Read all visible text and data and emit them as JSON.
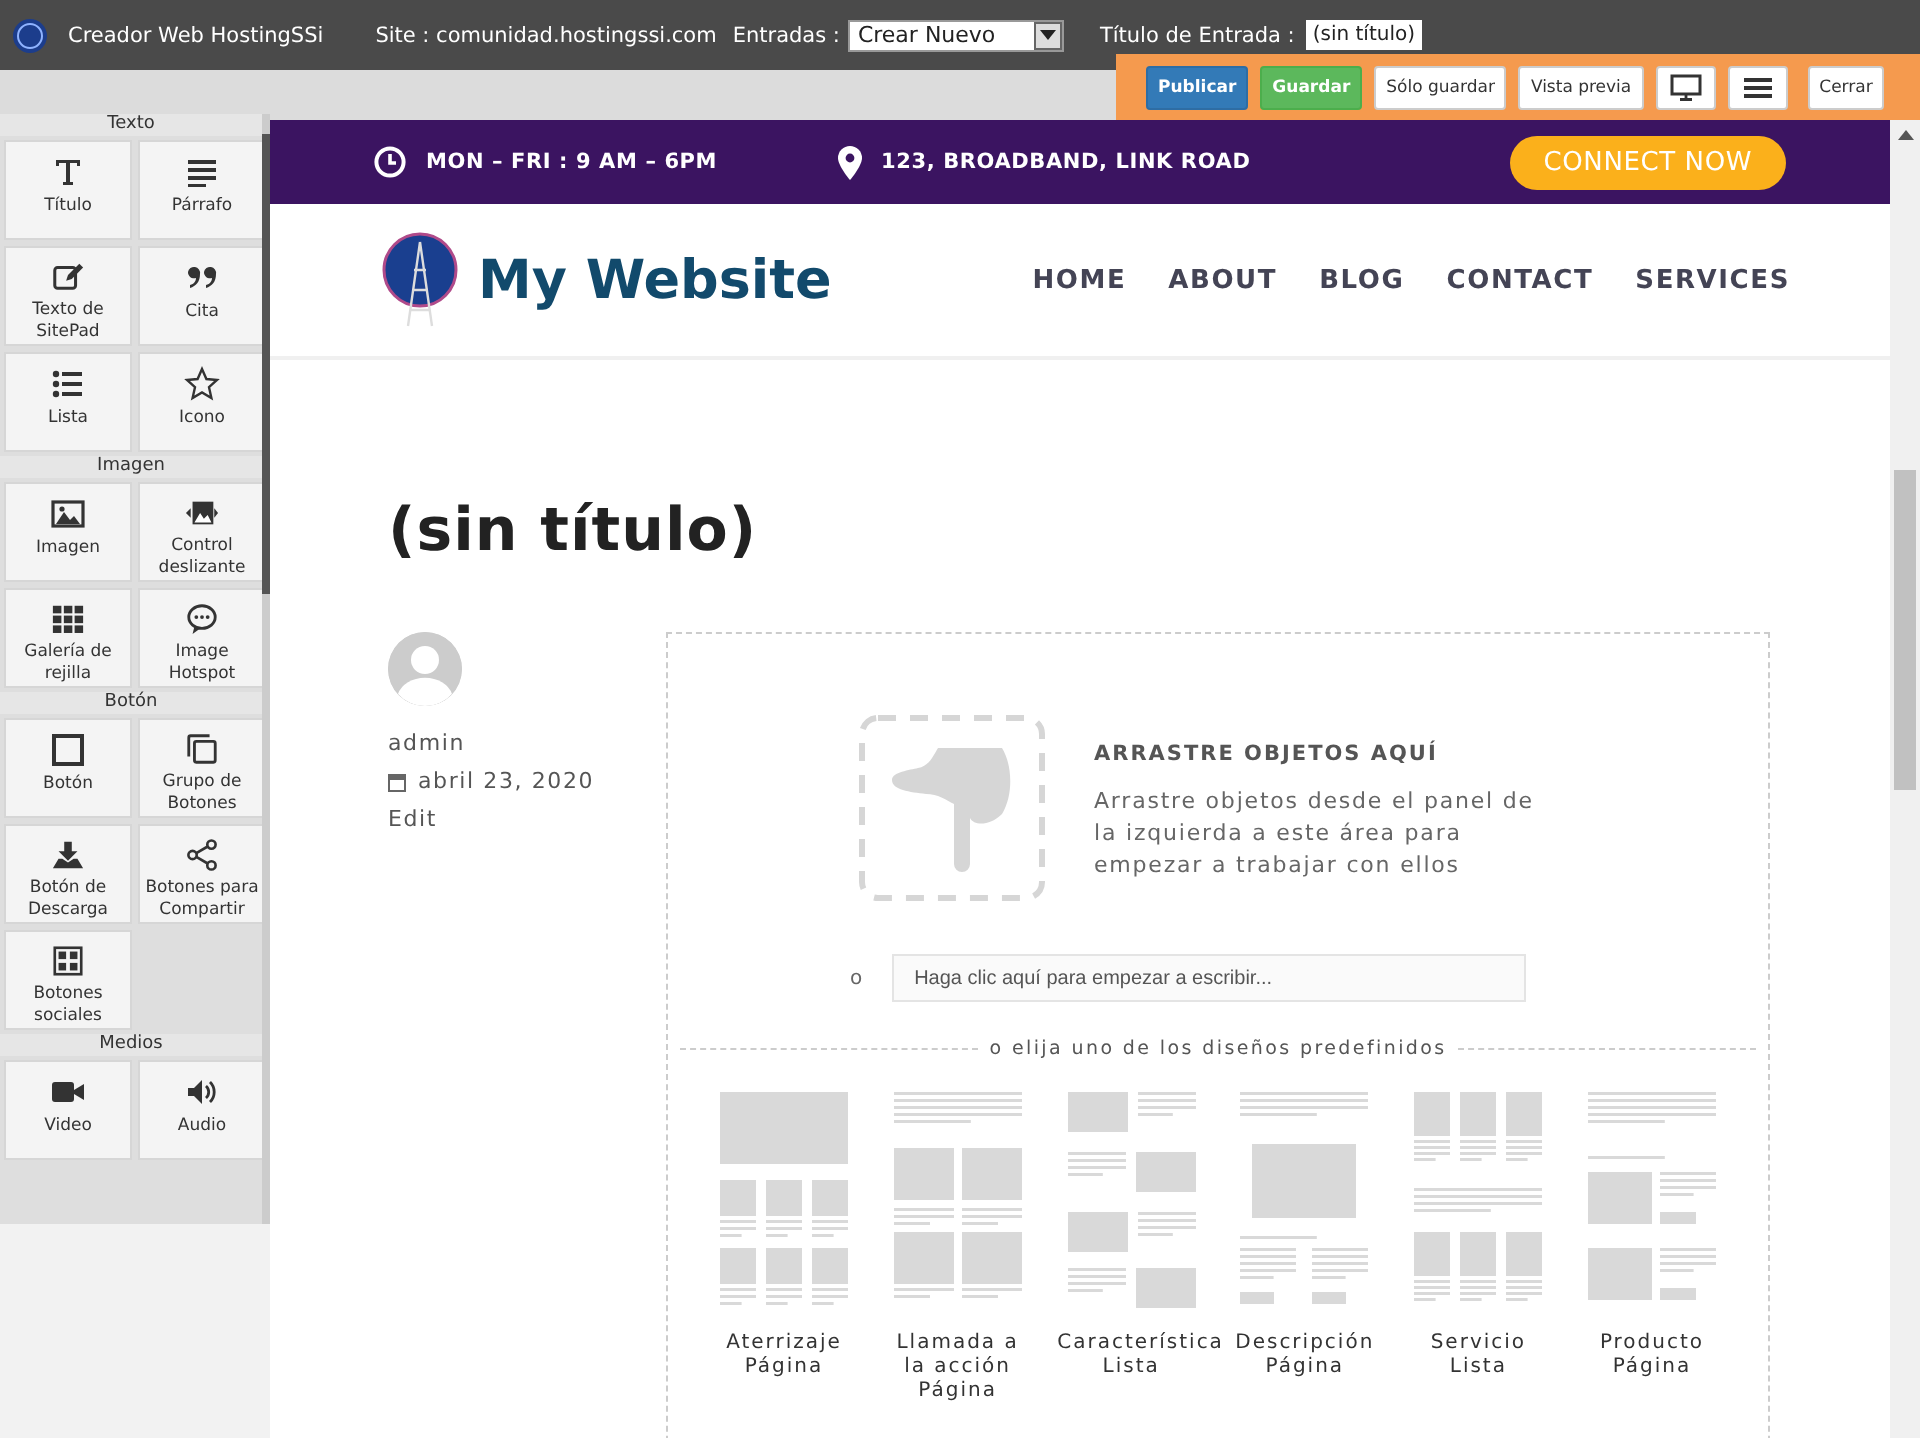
{
  "app": {
    "title": "Creador Web HostingSSi",
    "site": "Site : comunidad.hostingssi.com",
    "entries_label": "Entradas :",
    "entries_value": "Crear Nuevo",
    "entry_title_label": "Título de Entrada :",
    "entry_title_value": "(sin título)"
  },
  "toolbar": [
    {
      "kind": "primary",
      "label": "Publicar"
    },
    {
      "kind": "success",
      "label": "Guardar"
    },
    {
      "kind": "plain",
      "label": "Sólo guardar"
    },
    {
      "kind": "plain",
      "label": "Vista previa"
    },
    {
      "kind": "desktop"
    },
    {
      "kind": "menu"
    },
    {
      "kind": "plain",
      "label": "Cerrar"
    }
  ],
  "sidebar": [
    {
      "title": "Texto",
      "items": [
        {
          "label": "Título"
        },
        {
          "label": "Párrafo"
        },
        {
          "label": "Texto de SitePad"
        },
        {
          "label": "Cita"
        },
        {
          "label": "Lista"
        },
        {
          "label": "Icono"
        }
      ]
    },
    {
      "title": "Imagen",
      "items": [
        {
          "label": "Imagen"
        },
        {
          "label": "Control deslizante"
        },
        {
          "label": "Galería de rejilla"
        },
        {
          "label": "Image Hotspot"
        }
      ]
    },
    {
      "title": "Botón",
      "items": [
        {
          "label": "Botón"
        },
        {
          "label": "Grupo de Botones"
        },
        {
          "label": "Botón de Descarga"
        },
        {
          "label": "Botones para Compartir"
        },
        {
          "label": "Botones sociales"
        }
      ]
    },
    {
      "title": "Medios",
      "items": [
        {
          "label": "Video"
        },
        {
          "label": "Audio"
        }
      ]
    }
  ],
  "site": {
    "hours": "MON – FRI : 9 AM – 6PM",
    "address": "123, BROADBAND, LINK ROAD",
    "cta": "CONNECT NOW",
    "brand": "My Website",
    "nav": [
      "HOME",
      "ABOUT",
      "BLOG",
      "CONTACT",
      "SERVICES"
    ]
  },
  "post": {
    "title": "(sin título)",
    "author": "admin",
    "date": "abril 23, 2020",
    "edit": "Edit"
  },
  "dropzone": {
    "heading": "ARRASTRE OBJETOS AQUÍ",
    "text": "Arrastre objetos desde el panel de la izquierda a este área para empezar a trabajar con ellos",
    "or": "o",
    "placeholder": "Haga clic aquí para empezar a escribir...",
    "divider": "o elija uno de los diseños predefinidos",
    "layouts": [
      {
        "label": "Aterrizaje Página"
      },
      {
        "label": "Llamada a la acción Página"
      },
      {
        "label": "Característica Lista"
      },
      {
        "label": "Descripción Página"
      },
      {
        "label": "Servicio Lista"
      },
      {
        "label": "Producto Página"
      }
    ]
  }
}
